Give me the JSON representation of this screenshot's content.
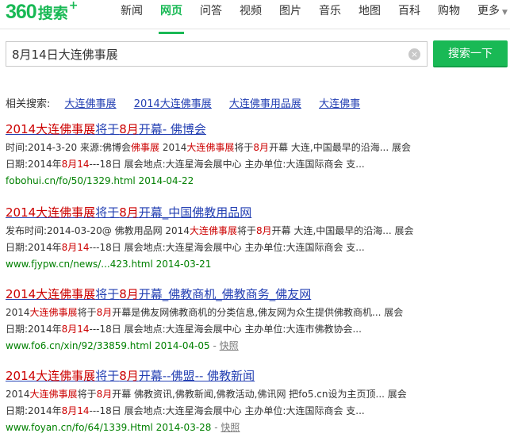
{
  "logo": {
    "num": "360",
    "cn": "搜索",
    "plus": "+"
  },
  "nav": {
    "items": [
      {
        "label": "新闻"
      },
      {
        "label": "网页"
      },
      {
        "label": "问答"
      },
      {
        "label": "视频"
      },
      {
        "label": "图片"
      },
      {
        "label": "音乐"
      },
      {
        "label": "地图"
      },
      {
        "label": "百科"
      },
      {
        "label": "购物"
      },
      {
        "label": "更多"
      }
    ]
  },
  "search": {
    "value": "8月14日大连佛事展",
    "button_label": "搜索一下",
    "clear_glyph": "×"
  },
  "related": {
    "label": "相关搜索:",
    "items": [
      "大连佛事展",
      "2014大连佛事展",
      "大连佛事用品展",
      "大连佛事"
    ]
  },
  "results": [
    {
      "title": [
        "2014大连佛事展",
        "将于",
        "8月",
        "开幕- 佛博会"
      ],
      "desc1": [
        "时间:2014-3-20 来源:佛博会",
        "佛事展",
        " 2014",
        "大连佛事展",
        "将于",
        "8月",
        "开幕 大连,中国最早的沿海... 展会"
      ],
      "desc2": [
        "日期:2014年",
        "8月14",
        "---18日 展会地点:大连星海会展中心 主办单位:大连国际商会 支..."
      ],
      "url": "fobohui.cn/fo/50/1329.html 2014-04-22",
      "cache": ""
    },
    {
      "title": [
        "2014大连佛事展",
        "将于",
        "8月",
        "开幕_中国佛教用品网"
      ],
      "desc1": [
        "发布时间:2014-03-20@ 佛教用品网 2014",
        "大连佛事展",
        "将于",
        "8月",
        "开幕 大连,中国最早的沿海... 展会"
      ],
      "desc2": [
        "日期:2014年",
        "8月14",
        "---18日 展会地点:大连星海会展中心 主办单位:大连国际商会 支..."
      ],
      "url": "www.fjypw.cn/news/...423.html 2014-03-21",
      "cache": ""
    },
    {
      "title": [
        "2014大连佛事展",
        "将于",
        "8月",
        "开幕_佛教商机_佛教商务_佛友网"
      ],
      "desc1": [
        "2014",
        "大连佛事展",
        "将于",
        "8月",
        "开幕是佛友网佛教商机的分类信息,佛友网为众生提供佛教商机... 展会"
      ],
      "desc2": [
        "日期:2014年",
        "8月14",
        "---18日 展会地点:大连星海会展中心 主办单位:大连市佛教协会..."
      ],
      "url": "www.fo6.cn/xin/92/33859.html 2014-04-05",
      "cache": "快照"
    },
    {
      "title": [
        "2014大连佛事展",
        "将于",
        "8月",
        "开幕--佛盟-- 佛教新闻"
      ],
      "desc1": [
        "2014",
        "大连佛事展",
        "将于",
        "8月",
        "开幕 佛教资讯,佛教新闻,佛教活动,佛讯网 把fo5.cn设为主页顶... 展会"
      ],
      "desc2": [
        "日期:2014年",
        "8月14",
        "---18日 展会地点:大连星海会展中心 主办单位:大连国际商会 支..."
      ],
      "url": "www.foyan.cn/fo/64/1339.Html 2014-03-28",
      "cache": "快照"
    }
  ],
  "colors": {
    "accent": "#19b955",
    "link": "#2440b3",
    "highlight": "#cc0000",
    "url": "#008000"
  }
}
